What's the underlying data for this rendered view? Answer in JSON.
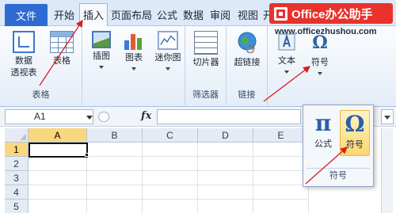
{
  "tabs": {
    "file": "文件",
    "items": [
      "开始",
      "插入",
      "页面布局",
      "公式",
      "数据",
      "审阅",
      "视图",
      "开"
    ],
    "active": "插入"
  },
  "brand": {
    "text": "Office办公助手",
    "url": "www.officezhushou.com"
  },
  "ribbon": {
    "groups": [
      {
        "label": "表格",
        "buttons": [
          "数据\n透视表",
          "表格"
        ]
      },
      {
        "label": "",
        "buttons": [
          "插图",
          "图表",
          "迷你图"
        ]
      },
      {
        "label": "筛选器",
        "buttons": [
          "切片器"
        ]
      },
      {
        "label": "链接",
        "buttons": [
          "超链接"
        ]
      },
      {
        "label": "",
        "buttons": [
          "文本",
          "符号"
        ]
      }
    ]
  },
  "formula_bar": {
    "name_box": "A1",
    "fx": "fx",
    "value": ""
  },
  "grid": {
    "columns": [
      "A",
      "B",
      "C",
      "D",
      "E"
    ],
    "rows": [
      "1",
      "2",
      "3",
      "4",
      "5"
    ],
    "active_cell": "A1"
  },
  "popup": {
    "group_label": "符号",
    "buttons": [
      {
        "glyph": "π",
        "label": "公式"
      },
      {
        "glyph": "Ω",
        "label": "符号"
      }
    ]
  },
  "colors": {
    "accent": "#2f6ad0",
    "brand": "#e8322b",
    "annotation": "#d42020",
    "highlight": "#fbd86e"
  }
}
